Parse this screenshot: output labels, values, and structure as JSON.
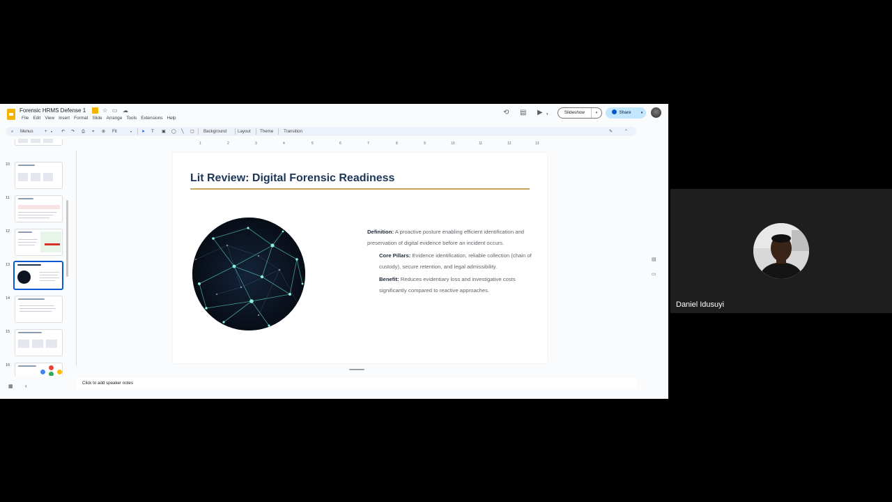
{
  "document": {
    "title": "Forensic HRMS Defense 1",
    "menu": [
      "File",
      "Edit",
      "View",
      "Insert",
      "Format",
      "Slide",
      "Arrange",
      "Tools",
      "Extensions",
      "Help"
    ]
  },
  "header": {
    "slideshow_label": "Slideshow",
    "share_label": "Share"
  },
  "toolbar": {
    "menus_label": "Menus",
    "zoom_label": "Fit",
    "background_label": "Background",
    "layout_label": "Layout",
    "theme_label": "Theme",
    "transition_label": "Transition"
  },
  "ruler": {
    "ticks": [
      "1",
      "2",
      "3",
      "4",
      "5",
      "6",
      "7",
      "8",
      "9",
      "10",
      "11",
      "12",
      "13"
    ]
  },
  "filmstrip": {
    "slides": [
      {
        "number": "10"
      },
      {
        "number": "11"
      },
      {
        "number": "12"
      },
      {
        "number": "13",
        "selected": true
      },
      {
        "number": "14"
      },
      {
        "number": "15"
      },
      {
        "number": "16"
      }
    ]
  },
  "slide": {
    "title": "Lit Review: Digital Forensic Readiness",
    "definition_label": "Definition:",
    "definition_text": " A proactive posture enabling efficient identification and preservation of digital evidence before an incident occurs.",
    "pillars_label": "Core Pillars:",
    "pillars_text": " Evidence identification, reliable collection (chain of custody), secure retention, and legal admissibility.",
    "benefit_label": "Benefit:",
    "benefit_text": " Reduces evidentiary loss and investigative costs significantly compared to reactive approaches.",
    "accent_color": "#c8a45a",
    "title_color": "#1d3557"
  },
  "notes": {
    "placeholder": "Click to add speaker notes"
  },
  "participant": {
    "name": "Daniel Idusuyi"
  },
  "colors": {
    "share_button": "#c2e7ff",
    "selection": "#0b57d0"
  }
}
